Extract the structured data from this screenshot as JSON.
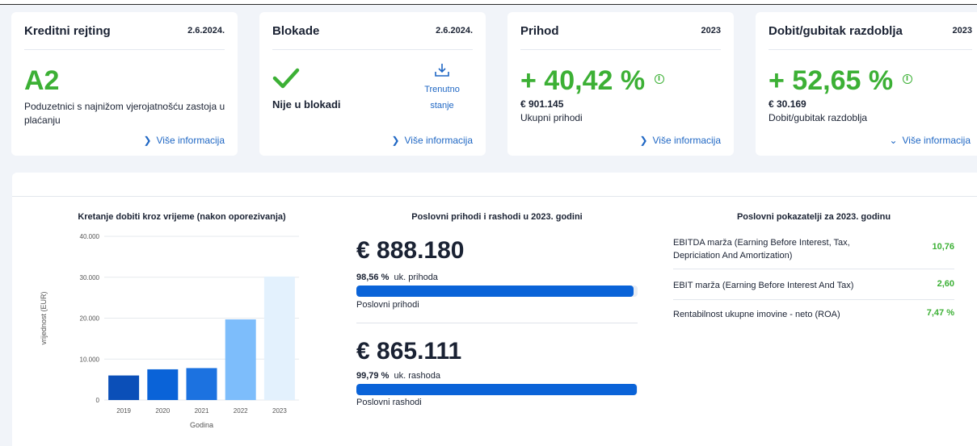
{
  "cards": [
    {
      "title": "Kreditni rejting",
      "date": "2.6.2024.",
      "big": "A2",
      "desc": "Poduzetnici s najnižom vjerojatnošću zastoja u plaćanju",
      "more": "Više informacija"
    },
    {
      "title": "Blokade",
      "date": "2.6.2024.",
      "status": "Nije u blokadi",
      "action": "Trenutno stanje",
      "more": "Više informacija"
    },
    {
      "title": "Prihod",
      "date": "2023",
      "big": "+ 40,42 %",
      "amount": "€ 901.145",
      "desc": "Ukupni prihodi",
      "more": "Više informacija"
    },
    {
      "title": "Dobit/gubitak razdoblja",
      "date": "2023",
      "big": "+ 52,65 %",
      "amount": "€ 30.169",
      "desc": "Dobit/gubitak razdoblja",
      "more": "Više informacija"
    }
  ],
  "profit_chart_title": "Kretanje dobiti kroz vrijeme (nakon oporezivanja)",
  "revenue_title": "Poslovni prihodi i rashodi u 2023. godini",
  "indicators_title": "Poslovni pokazatelji za 2023. godinu",
  "revenue": {
    "income_amount": "€ 888.180",
    "income_pct": "98,56 %",
    "income_pct_label": "uk. prihoda",
    "income_label": "Poslovni prihodi",
    "income_fill": 0.9856,
    "expense_amount": "€ 865.111",
    "expense_pct": "99,79 %",
    "expense_pct_label": "uk. rashoda",
    "expense_label": "Poslovni rashodi",
    "expense_fill": 0.9979
  },
  "indicators": [
    {
      "label": "EBITDA marža (Earning Before Interest, Tax, Depriciation And Amortization)",
      "value": "10,76"
    },
    {
      "label": "EBIT marža (Earning Before Interest And Tax)",
      "value": "2,60"
    },
    {
      "label": "Rentabilnost ukupne imovine - neto (ROA)",
      "value": "7,47 %"
    }
  ],
  "colors": {
    "green": "#3cb035",
    "blue": "#1f67c4"
  },
  "chart_data": {
    "type": "bar",
    "title": "Kretanje dobiti kroz vrijeme (nakon oporezivanja)",
    "xlabel": "Godina",
    "ylabel": "vrijednost (EUR)",
    "categories": [
      "2019",
      "2020",
      "2021",
      "2022",
      "2023"
    ],
    "values": [
      6000,
      7500,
      7800,
      19700,
      30169
    ],
    "colors": [
      "#0b4fb8",
      "#0a63d8",
      "#1c72e0",
      "#7dbdfb",
      "#e3f1fd"
    ],
    "ylim": [
      0,
      40000
    ],
    "yticks": [
      0,
      10000,
      20000,
      30000,
      40000
    ],
    "ytick_labels": [
      "0",
      "10.000",
      "20.000",
      "30.000",
      "40.000"
    ],
    "grid": true
  }
}
